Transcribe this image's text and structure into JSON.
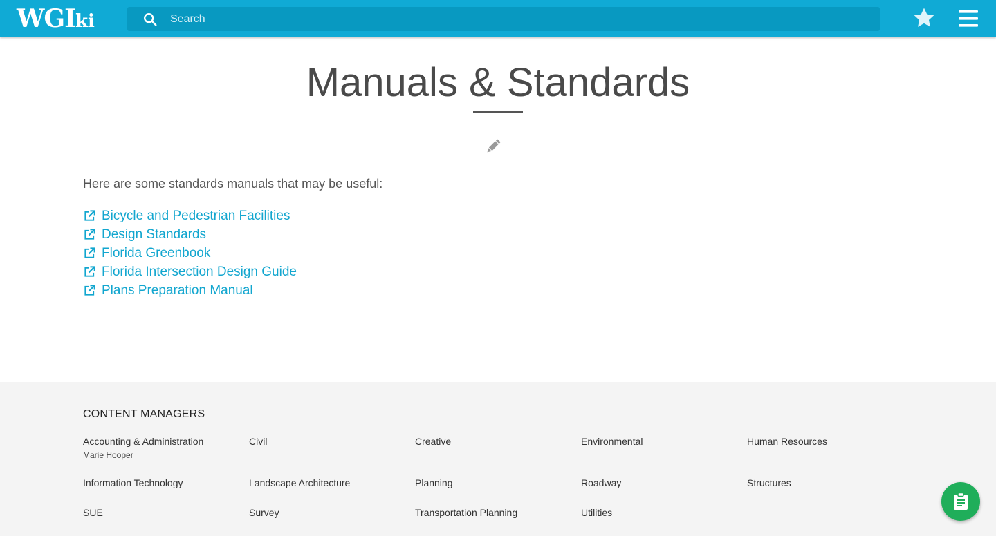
{
  "header": {
    "logo_main": "WGI",
    "logo_suffix": "ki",
    "search_placeholder": "Search",
    "search_value": "",
    "accent_color": "#10aad5",
    "icons": [
      "search-icon",
      "star-icon",
      "hamburger-menu-icon"
    ]
  },
  "main": {
    "title": "Manuals & Standards",
    "intro": "Here are some standards manuals that may be useful:",
    "links": [
      {
        "label": "Bicycle and Pedestrian Facilities",
        "icon": "external-link-icon"
      },
      {
        "label": "Design Standards",
        "icon": "external-link-icon"
      },
      {
        "label": "Florida Greenbook",
        "icon": "external-link-icon"
      },
      {
        "label": "Florida Intersection Design Guide",
        "icon": "external-link-icon"
      },
      {
        "label": "Plans Preparation Manual",
        "icon": "external-link-icon"
      }
    ],
    "link_color": "#12a6cf",
    "edit_icon": "pencil-icon"
  },
  "footer": {
    "heading": "CONTENT MANAGERS",
    "managers": [
      {
        "department": "Accounting & Administration",
        "manager": "Marie Hooper"
      },
      {
        "department": "Civil"
      },
      {
        "department": "Creative"
      },
      {
        "department": "Environmental"
      },
      {
        "department": "Human Resources"
      },
      {
        "department": "Information Technology"
      },
      {
        "department": "Landscape Architecture"
      },
      {
        "department": "Planning"
      },
      {
        "department": "Roadway"
      },
      {
        "department": "Structures"
      },
      {
        "department": "SUE"
      },
      {
        "department": "Survey"
      },
      {
        "department": "Transportation Planning"
      },
      {
        "department": "Utilities"
      }
    ]
  },
  "fab": {
    "icon": "clipboard-icon",
    "color": "#1fae5a"
  }
}
